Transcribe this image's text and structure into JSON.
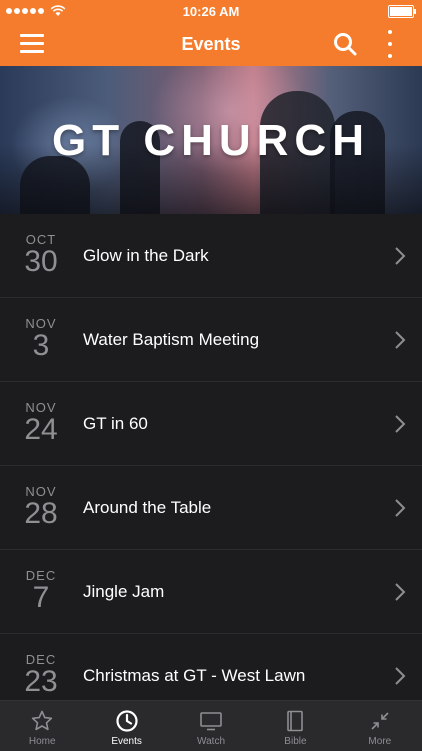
{
  "status_bar": {
    "time": "10:26 AM",
    "signal_icon": "signal-dots-icon",
    "wifi_icon": "wifi-icon",
    "battery_icon": "battery-icon"
  },
  "app_bar": {
    "title": "Events",
    "menu_icon": "hamburger-menu-icon",
    "search_icon": "search-icon",
    "more_icon": "more-vertical-icon",
    "color": "#f47c2c"
  },
  "hero": {
    "title": "GT CHURCH"
  },
  "events": [
    {
      "month": "OCT",
      "day": "30",
      "title": "Glow in the Dark"
    },
    {
      "month": "NOV",
      "day": "3",
      "title": "Water Baptism Meeting"
    },
    {
      "month": "NOV",
      "day": "24",
      "title": "GT in 60"
    },
    {
      "month": "NOV",
      "day": "28",
      "title": "Around the Table"
    },
    {
      "month": "DEC",
      "day": "7",
      "title": "Jingle Jam"
    },
    {
      "month": "DEC",
      "day": "23",
      "title": "Christmas at GT - West Lawn"
    }
  ],
  "tabs": [
    {
      "label": "Home",
      "icon": "star-icon",
      "active": false
    },
    {
      "label": "Events",
      "icon": "clock-icon",
      "active": true
    },
    {
      "label": "Watch",
      "icon": "tv-icon",
      "active": false
    },
    {
      "label": "Bible",
      "icon": "book-icon",
      "active": false
    },
    {
      "label": "More",
      "icon": "collapse-arrows-icon",
      "active": false
    }
  ]
}
